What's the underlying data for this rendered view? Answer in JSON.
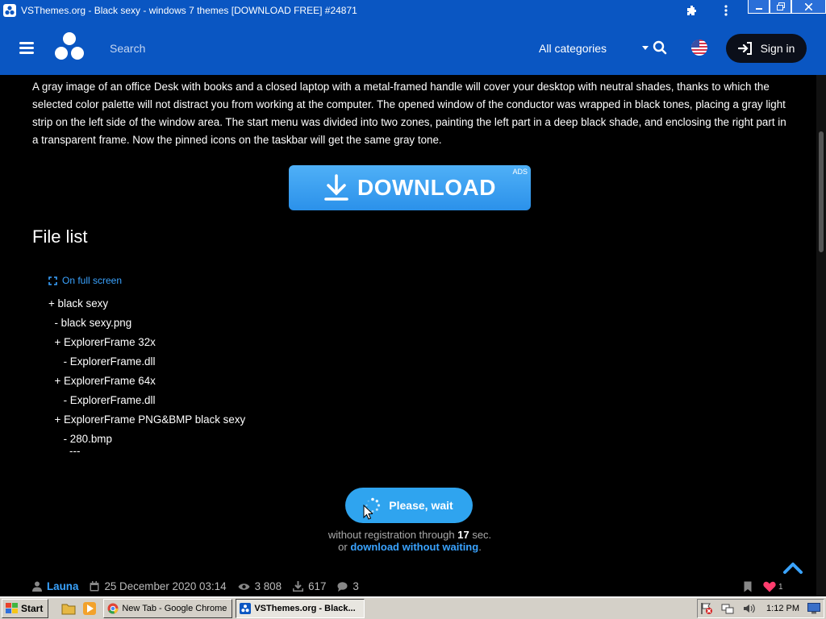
{
  "browser": {
    "title": "VSThemes.org - Black sexy - windows 7 themes [DOWNLOAD FREE] #24871"
  },
  "nav": {
    "search_placeholder": "Search",
    "categories": "All categories",
    "signin": "Sign in"
  },
  "article": {
    "description": "A gray image of an office Desk with books and a closed laptop with a metal-framed handle will cover your desktop with neutral shades, thanks to which the selected color palette will not distract you from working at the computer. The opened window of the conductor was wrapped in black tones, placing a gray light strip on the left side of the window area. The start menu was divided into two zones, painting the left part in a deep black shade, and enclosing the right part in a transparent frame.  Now the pinned icons on the taskbar will get the same gray tone.",
    "download_label": "DOWNLOAD",
    "ads_label": "ADS",
    "file_list_heading": "File list",
    "fullscreen_label": "On full screen",
    "files": [
      "+ black sexy",
      "  - black sexy.png",
      "  + ExplorerFrame 32x",
      "     - ExplorerFrame.dll",
      "  + ExplorerFrame 64x",
      "     - ExplorerFrame.dll",
      "  + ExplorerFrame PNG&BMP black sexy",
      "     - 280.bmp",
      "       ---"
    ],
    "wait_button": "Please, wait",
    "wait_text_1": "without registration through ",
    "wait_seconds": "17",
    "wait_text_2": " sec.",
    "wait_or": "or ",
    "wait_link": "download without waiting",
    "wait_dot": "."
  },
  "meta": {
    "author": "Launa",
    "date": "25 December 2020 03:14",
    "views": "3 808",
    "downloads": "617",
    "comments": "3",
    "likes": "1"
  },
  "taskbar": {
    "start": "Start",
    "tasks": [
      "New Tab - Google Chrome",
      "VSThemes.org - Black..."
    ],
    "clock": "1:12 PM"
  },
  "colors": {
    "brand_blue": "#0a56c2",
    "accent": "#3aa3ff",
    "download_button": "#2b91ea"
  }
}
